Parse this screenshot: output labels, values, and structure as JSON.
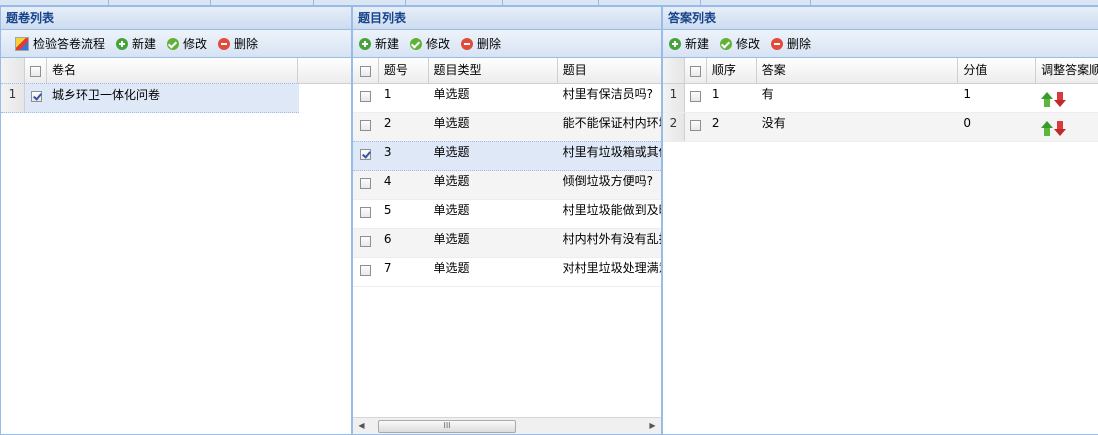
{
  "papers_panel": {
    "title": "题卷列表",
    "toolbar": {
      "check_label": "检验答卷流程",
      "add_label": "新建",
      "edit_label": "修改",
      "delete_label": "删除"
    },
    "columns": {
      "name": "卷名"
    },
    "rows": [
      {
        "rownum": "1",
        "checked": true,
        "name": "城乡环卫一体化问卷"
      }
    ]
  },
  "questions_panel": {
    "title": "题目列表",
    "toolbar": {
      "add_label": "新建",
      "edit_label": "修改",
      "delete_label": "删除"
    },
    "columns": {
      "number": "题号",
      "type": "题目类型",
      "question": "题目"
    },
    "rows": [
      {
        "number": "1",
        "type": "单选题",
        "question": "村里有保洁员吗?",
        "checked": false
      },
      {
        "number": "2",
        "type": "单选题",
        "question": "能不能保证村内环境",
        "checked": false
      },
      {
        "number": "3",
        "type": "单选题",
        "question": "村里有垃圾箱或其他",
        "checked": true
      },
      {
        "number": "4",
        "type": "单选题",
        "question": "倾倒垃圾方便吗?",
        "checked": false
      },
      {
        "number": "5",
        "type": "单选题",
        "question": "村里垃圾能做到及时",
        "checked": false
      },
      {
        "number": "6",
        "type": "单选题",
        "question": "村内村外有没有乱扔",
        "checked": false
      },
      {
        "number": "7",
        "type": "单选题",
        "question": "对村里垃圾处理满意",
        "checked": false
      }
    ],
    "scrollbar_thumb": "III"
  },
  "answers_panel": {
    "title": "答案列表",
    "toolbar": {
      "add_label": "新建",
      "edit_label": "修改",
      "delete_label": "删除"
    },
    "columns": {
      "order": "顺序",
      "answer": "答案",
      "score": "分值",
      "adjust": "调整答案顺序"
    },
    "rows": [
      {
        "rownum": "1",
        "order": "1",
        "answer": "有",
        "score": "1"
      },
      {
        "rownum": "2",
        "order": "2",
        "answer": "没有",
        "score": "0"
      }
    ]
  }
}
